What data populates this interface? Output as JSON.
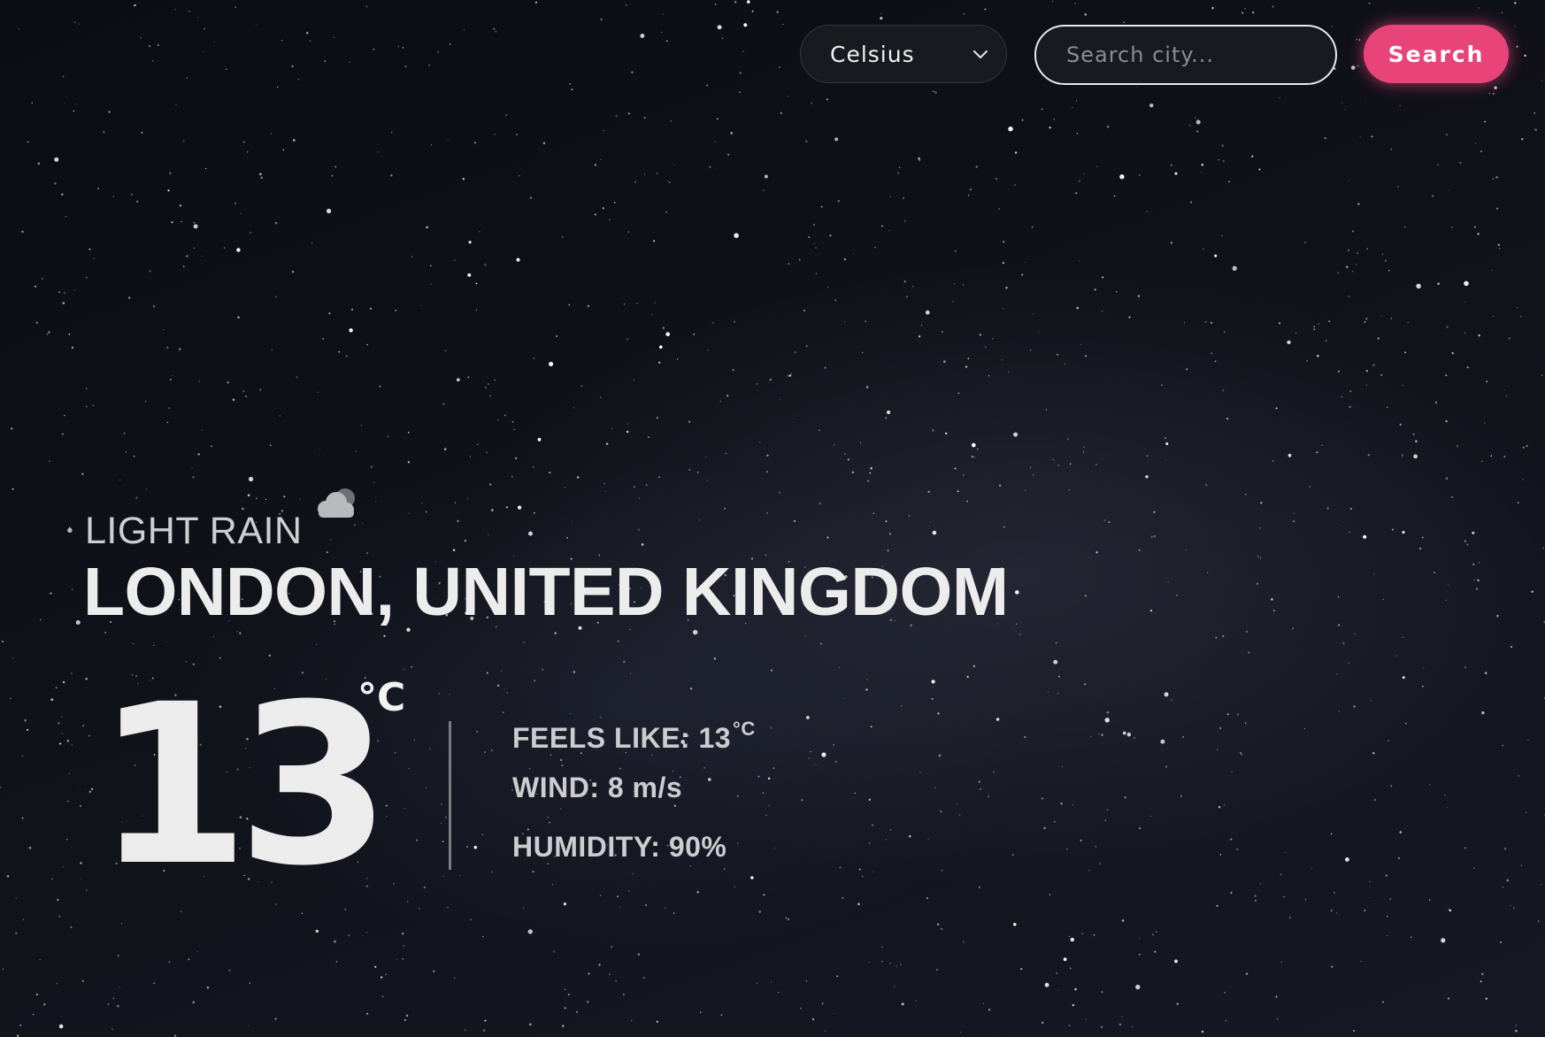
{
  "colors": {
    "accent": "#e8447a",
    "background": "#0d0e14",
    "text": "#ececec"
  },
  "header": {
    "unit_select": {
      "selected": "Celsius",
      "icon": "chevron-down-icon"
    },
    "search": {
      "placeholder": "Search city...",
      "value": ""
    },
    "search_button_label": "Search"
  },
  "weather": {
    "condition": "LIGHT RAIN",
    "condition_icon": "cloud-icon",
    "location": "LONDON, UNITED KINGDOM",
    "temperature": "13",
    "temperature_unit": "°C",
    "feels_like": {
      "label": "FEELS LIKE:",
      "value": "13",
      "unit": "°C"
    },
    "wind": {
      "label": "WIND:",
      "value": "8 m/s"
    },
    "humidity": {
      "label": "HUMIDITY:",
      "value": "90%"
    }
  }
}
